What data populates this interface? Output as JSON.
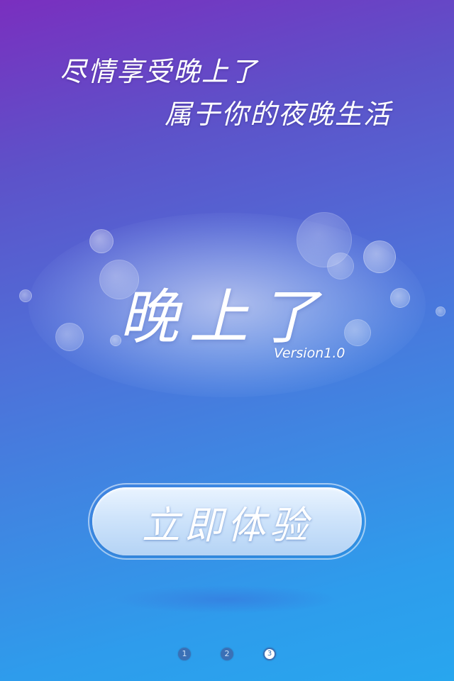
{
  "app": {
    "name": "晚上了",
    "version": "Version1.0"
  },
  "slogan": {
    "line1": "尽情享受晚上了",
    "line2": "属于你的夜晚生活"
  },
  "start_button": {
    "label": "立即体验"
  },
  "pager": {
    "pages": [
      "1",
      "2",
      "3"
    ],
    "current": "3"
  },
  "colors": {
    "gradient_top": "#7a2fbf",
    "gradient_bottom": "#28a6ee",
    "button_fill": "#cfe4fb",
    "dot": "#3a70b6"
  }
}
